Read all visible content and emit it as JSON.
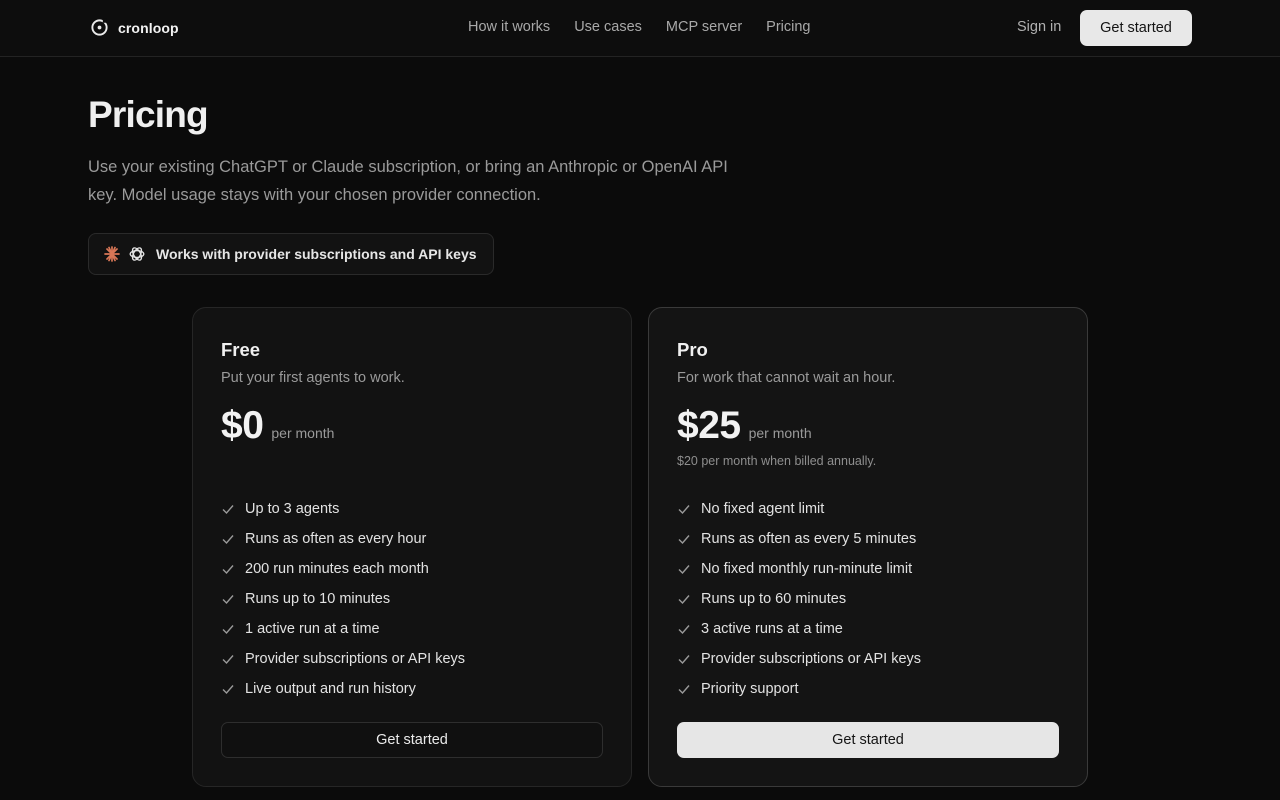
{
  "header": {
    "brand": "cronloop",
    "nav": [
      "How it works",
      "Use cases",
      "MCP server",
      "Pricing"
    ],
    "signin_label": "Sign in",
    "cta_label": "Get started"
  },
  "hero": {
    "title": "Pricing",
    "subtitle": "Use your existing ChatGPT or Claude subscription, or bring an Anthropic or OpenAI API key. Model usage stays with your chosen provider connection.",
    "badge": "Works with provider subscriptions and API keys"
  },
  "plans": [
    {
      "name": "Free",
      "description": "Put your first agents to work.",
      "price": "$0",
      "period": "per month",
      "annual_note": "",
      "features": [
        "Up to 3 agents",
        "Runs as often as every hour",
        "200 run minutes each month",
        "Runs up to 10 minutes",
        "1 active run at a time",
        "Provider subscriptions or API keys",
        "Live output and run history"
      ],
      "button_label": "Get started"
    },
    {
      "name": "Pro",
      "description": "For work that cannot wait an hour.",
      "price": "$25",
      "period": "per month",
      "annual_note": "$20 per month when billed annually.",
      "features": [
        "No fixed agent limit",
        "Runs as often as every 5 minutes",
        "No fixed monthly run-minute limit",
        "Runs up to 60 minutes",
        "3 active runs at a time",
        "Provider subscriptions or API keys",
        "Priority support"
      ],
      "button_label": "Get started"
    }
  ],
  "icons": {
    "logo": "cronloop-logo-icon",
    "badge": [
      "anthropic-icon",
      "openai-icon"
    ],
    "feature": "check-icon"
  },
  "colors": {
    "background": "#0b0b0b",
    "anthropic_accent": "#d97757",
    "button_light": "#e8e8e8"
  }
}
